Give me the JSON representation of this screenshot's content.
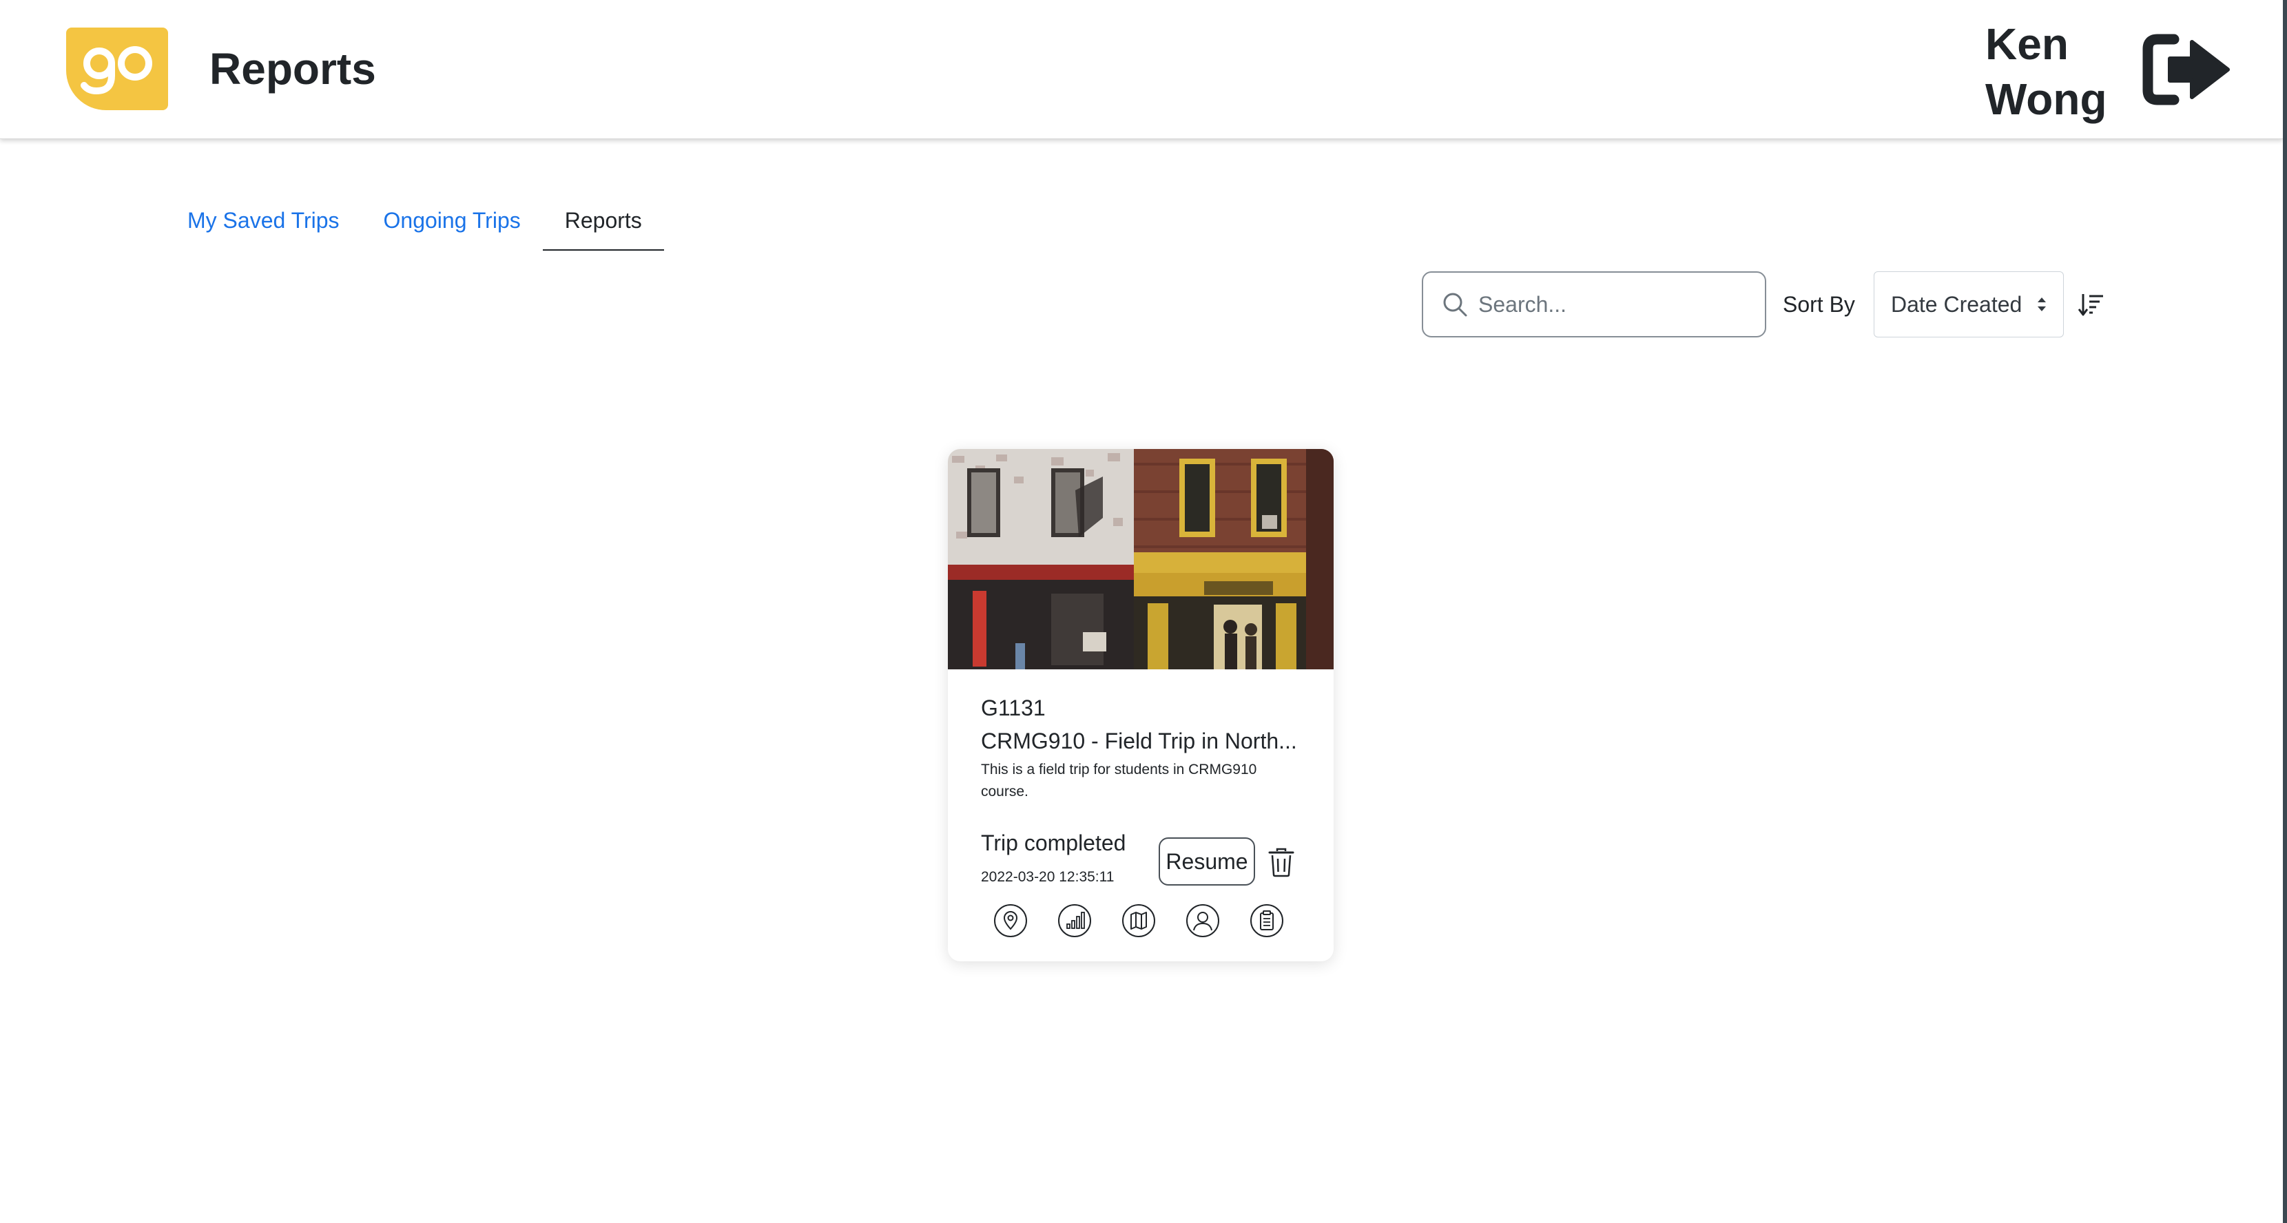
{
  "header": {
    "logo_text": "go",
    "title": "Reports",
    "user_name": "Ken Wong",
    "logout_icon": "sign-out-icon"
  },
  "tabs": [
    {
      "label": "My Saved Trips",
      "active": false
    },
    {
      "label": "Ongoing Trips",
      "active": false
    },
    {
      "label": "Reports",
      "active": true
    }
  ],
  "toolbar": {
    "search_placeholder": "Search...",
    "search_value": "",
    "sort_label": "Sort By",
    "sort_selected": "Date Created",
    "sort_direction_icon": "sort-descending-icon"
  },
  "cards": [
    {
      "id": "G1131",
      "name": "CRMG910 - Field Trip in North...",
      "description": "This is a field trip for students in CRMG910 course.",
      "status": "Trip completed",
      "date": "2022-03-20 12:35:11",
      "resume_label": "Resume",
      "image_icon": "storefront-photo",
      "action_icons": [
        "map-pin-icon",
        "bar-chart-icon",
        "map-icon",
        "user-icon",
        "clipboard-icon"
      ]
    }
  ],
  "colors": {
    "brand_yellow": "#f4c542",
    "link_blue": "#1a73e8",
    "text_dark": "#212529"
  }
}
